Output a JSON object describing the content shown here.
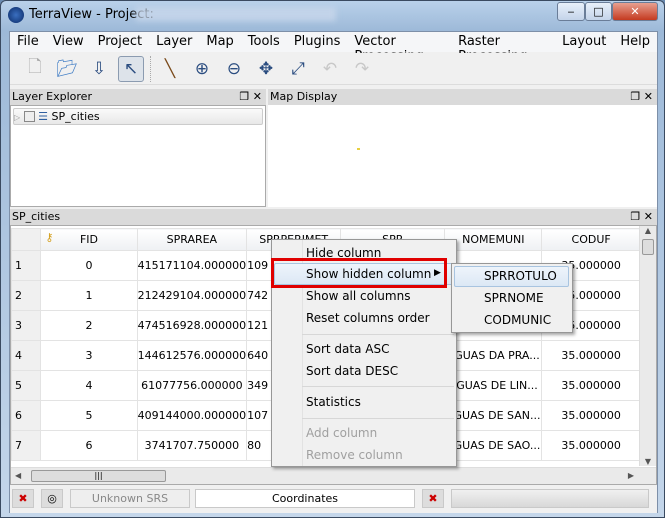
{
  "window": {
    "title": "TerraView - Project:"
  },
  "menubar": [
    "File",
    "View",
    "Project",
    "Layer",
    "Map",
    "Tools",
    "Plugins",
    "Vector Processing",
    "Raster Processing",
    "Layout",
    "Help"
  ],
  "toolbar": [
    "new-project-icon",
    "open-project-icon",
    "save-project-icon",
    "pointer-icon",
    "pencil-icon",
    "zoom-in-icon",
    "zoom-out-icon",
    "pan-icon",
    "zoom-extent-icon",
    "undo-icon",
    "redo-icon"
  ],
  "layer_explorer": {
    "title": "Layer Explorer",
    "layers": [
      {
        "name": "SP_cities",
        "checked": false
      }
    ]
  },
  "map_display": {
    "title": "Map Display"
  },
  "table_dock": {
    "title": "SP_cities",
    "columns": [
      "",
      "FID",
      "SPRAREA",
      "SPRPERIMET",
      "SPR",
      "NOMEMUNI",
      "CODUF"
    ],
    "rows": [
      {
        "n": "1",
        "fid": "0",
        "area": "415171104.000000",
        "per": "109",
        "c4": "",
        "nome": "",
        "coduf": "35.000000"
      },
      {
        "n": "2",
        "fid": "1",
        "area": "212429104.000000",
        "per": "742",
        "c4": "",
        "nome": "",
        "coduf": "35.000000"
      },
      {
        "n": "3",
        "fid": "2",
        "area": "474516928.000000",
        "per": "121",
        "c4": "",
        "nome": "",
        "coduf": "35.000000"
      },
      {
        "n": "4",
        "fid": "3",
        "area": "144612576.000000",
        "per": "640",
        "c4": "",
        "nome": "AGUAS DA PRA...",
        "coduf": "35.000000"
      },
      {
        "n": "5",
        "fid": "4",
        "area": "61077756.000000",
        "per": "349",
        "c4": "",
        "nome": "AGUAS DE LIN...",
        "coduf": "35.000000"
      },
      {
        "n": "6",
        "fid": "5",
        "area": "409144000.000000",
        "per": "107",
        "c4": "",
        "nome": "AGUAS DE SAN...",
        "coduf": "35.000000"
      },
      {
        "n": "7",
        "fid": "6",
        "area": "3741707.750000",
        "per": "80",
        "c4": "",
        "nome": "AGUAS DE SAO...",
        "coduf": "35.000000"
      }
    ]
  },
  "context_menu": {
    "hide": "Hide column",
    "show_hidden": "Show hidden column",
    "show_all": "Show all columns",
    "reset": "Reset columns order",
    "sort_asc": "Sort data ASC",
    "sort_desc": "Sort data DESC",
    "statistics": "Statistics",
    "add": "Add column",
    "remove": "Remove column"
  },
  "submenu": [
    "SPRROTULO",
    "SPRNOME",
    "CODMUNIC"
  ],
  "highlight_color": "#e00000",
  "status": {
    "srs": "Unknown SRS",
    "coordinates": "Coordinates"
  }
}
